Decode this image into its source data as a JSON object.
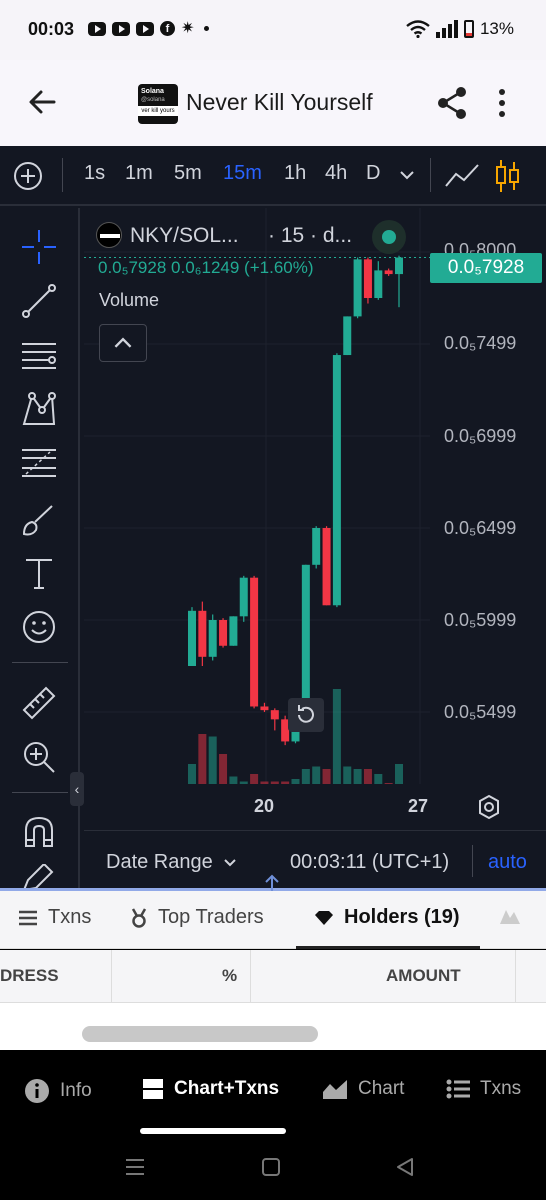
{
  "status_bar": {
    "time": "00:03",
    "battery": "13%"
  },
  "app_bar": {
    "title": "Never Kill Yourself",
    "token_logo": {
      "line1": "Solana",
      "line2": "@solana",
      "line3": "ver kill yours"
    }
  },
  "timeframes": [
    "1s",
    "1m",
    "5m",
    "15m",
    "1h",
    "4h",
    "D"
  ],
  "active_timeframe": "15m",
  "legend": {
    "symbol": "NKY/SOL...",
    "extra": "· 15 · d...",
    "ohlc": "0.0₅7928  0.0₆1249 (+1.60%)",
    "volume_label": "Volume"
  },
  "price_axis": {
    "labels": [
      "0.0₅8000",
      "0.0₅7499",
      "0.0₅6999",
      "0.0₅6499",
      "0.0₅5999",
      "0.0₅5499"
    ],
    "last_price": "0.0₅7928"
  },
  "time_axis": {
    "labels": [
      "20",
      "27"
    ]
  },
  "chart_bottom": {
    "date_range": "Date Range",
    "clock": "00:03:11 (UTC+1)",
    "auto": "auto"
  },
  "tabs": [
    {
      "label": "Txns"
    },
    {
      "label": "Top Traders"
    },
    {
      "label": "Holders (19)"
    }
  ],
  "active_tab": "Holders (19)",
  "table": {
    "columns": [
      "DRESS",
      "%",
      "AMOUNT"
    ]
  },
  "bottom_nav": [
    {
      "label": "Info"
    },
    {
      "label": "Chart+Txns"
    },
    {
      "label": "Chart"
    },
    {
      "label": "Txns"
    }
  ],
  "active_nav": "Chart+Txns",
  "colors": {
    "up": "#22ab94",
    "down": "#f23645",
    "accent": "#2962ff",
    "background": "#131722"
  },
  "chart_data": {
    "type": "candlestick",
    "price_ticks": [
      5.5e-06,
      6e-06,
      6.5e-06,
      7e-06,
      7.5e-06,
      8e-06
    ],
    "candles": [
      {
        "o": 5.75e-06,
        "h": 6.07e-06,
        "l": 5.75e-06,
        "c": 6.05e-06
      },
      {
        "o": 6.05e-06,
        "h": 6.1e-06,
        "l": 5.75e-06,
        "c": 5.8e-06
      },
      {
        "o": 5.8e-06,
        "h": 6.03e-06,
        "l": 5.78e-06,
        "c": 6e-06
      },
      {
        "o": 6e-06,
        "h": 6.01e-06,
        "l": 5.85e-06,
        "c": 5.86e-06
      },
      {
        "o": 5.86e-06,
        "h": 6.02e-06,
        "l": 5.86e-06,
        "c": 6.02e-06
      },
      {
        "o": 6.02e-06,
        "h": 6.24e-06,
        "l": 5.99e-06,
        "c": 6.23e-06
      },
      {
        "o": 6.23e-06,
        "h": 6.24e-06,
        "l": 5.52e-06,
        "c": 5.53e-06
      },
      {
        "o": 5.53e-06,
        "h": 5.55e-06,
        "l": 5.5e-06,
        "c": 5.51e-06
      },
      {
        "o": 5.51e-06,
        "h": 5.52e-06,
        "l": 5.4e-06,
        "c": 5.46e-06
      },
      {
        "o": 5.46e-06,
        "h": 5.48e-06,
        "l": 5.32e-06,
        "c": 5.34e-06
      },
      {
        "o": 5.34e-06,
        "h": 5.52e-06,
        "l": 5.33e-06,
        "c": 5.52e-06
      },
      {
        "o": 5.52e-06,
        "h": 6.3e-06,
        "l": 5.5e-06,
        "c": 6.3e-06
      },
      {
        "o": 6.3e-06,
        "h": 6.51e-06,
        "l": 6.28e-06,
        "c": 6.5e-06
      },
      {
        "o": 6.5e-06,
        "h": 6.51e-06,
        "l": 6.08e-06,
        "c": 6.08e-06
      },
      {
        "o": 6.08e-06,
        "h": 7.45e-06,
        "l": 6.07e-06,
        "c": 7.44e-06
      },
      {
        "o": 7.44e-06,
        "h": 7.65e-06,
        "l": 7.44e-06,
        "c": 7.65e-06
      },
      {
        "o": 7.65e-06,
        "h": 7.97e-06,
        "l": 7.64e-06,
        "c": 7.96e-06
      },
      {
        "o": 7.96e-06,
        "h": 7.97e-06,
        "l": 7.72e-06,
        "c": 7.75e-06
      },
      {
        "o": 7.75e-06,
        "h": 7.95e-06,
        "l": 7.74e-06,
        "c": 7.9e-06
      },
      {
        "o": 7.9e-06,
        "h": 7.91e-06,
        "l": 7.87e-06,
        "c": 7.88e-06
      },
      {
        "o": 7.88e-06,
        "h": 7.98e-06,
        "l": 7.7e-06,
        "c": 7.97e-06
      }
    ],
    "volume": [
      0.4,
      1.0,
      0.95,
      0.6,
      0.15,
      0.05,
      0.2,
      0.05,
      0.05,
      0.05,
      0.1,
      0.3,
      0.35,
      0.3,
      1.9,
      0.35,
      0.3,
      0.3,
      0.2,
      0.02,
      0.4
    ],
    "volume_max": 2.0
  }
}
